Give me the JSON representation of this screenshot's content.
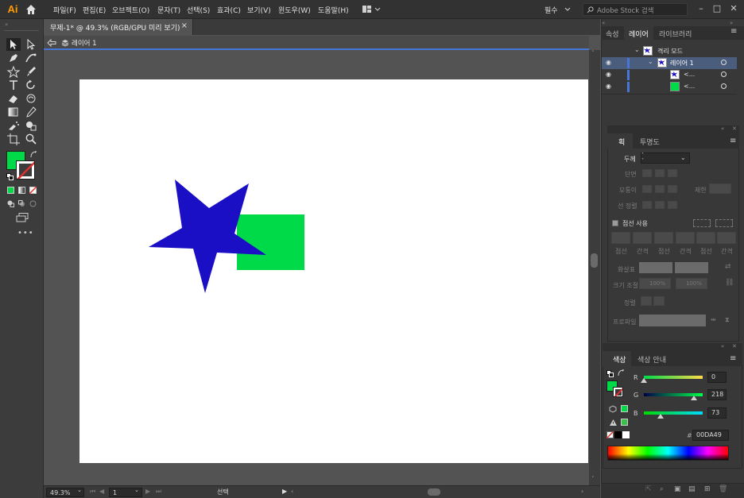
{
  "app": {
    "logo": "Ai"
  },
  "menu": [
    "파일(F)",
    "편집(E)",
    "오브젝트(O)",
    "문자(T)",
    "선택(S)",
    "효과(C)",
    "보기(V)",
    "윈도우(W)",
    "도움말(H)"
  ],
  "workspace": {
    "label": "필수"
  },
  "search": {
    "placeholder": "Adobe Stock 검색"
  },
  "document_tab": {
    "title": "무제-1* @ 49.3% (RGB/GPU 미리 보기)",
    "close": "×"
  },
  "breadcrumb": {
    "layer": "레이어 1"
  },
  "status": {
    "zoom": "49.3%",
    "artboard": "1",
    "tool": "선택"
  },
  "layers_panel": {
    "tabs": [
      "속성",
      "레이어",
      "라이브러리"
    ],
    "active_tab": "레이어",
    "rows": [
      {
        "label": "격리 모드"
      },
      {
        "label": "레이어 1"
      },
      {
        "label": "<..."
      },
      {
        "label": "<..."
      }
    ]
  },
  "stroke_panel": {
    "tabs": [
      "획",
      "투명도"
    ],
    "weight_label": "두께",
    "cap_label": "단면",
    "corner_label": "모퉁이",
    "limit_label": "제한",
    "align_label": "선 정렬",
    "dashed_label": "점선 사용",
    "dash_cols": [
      "점선",
      "간격",
      "점선",
      "간격",
      "점선",
      "간격"
    ],
    "arrow_label": "화살표",
    "scale_label": "크기 조절",
    "scale_1": "100%",
    "scale_2": "100%",
    "align2_label": "정렬",
    "profile_label": "프로파일"
  },
  "color_panel": {
    "tabs": [
      "색상",
      "색상 안내"
    ],
    "channels": [
      {
        "name": "R",
        "value": "0",
        "fraction": 0.0
      },
      {
        "name": "G",
        "value": "218",
        "fraction": 0.855
      },
      {
        "name": "B",
        "value": "73",
        "fraction": 0.286
      }
    ],
    "hex_prefix": "#",
    "hex": "00DA49"
  },
  "colors": {
    "fill": "#00DA49",
    "star": "#1A0FC4",
    "accent": "#4676D7"
  }
}
